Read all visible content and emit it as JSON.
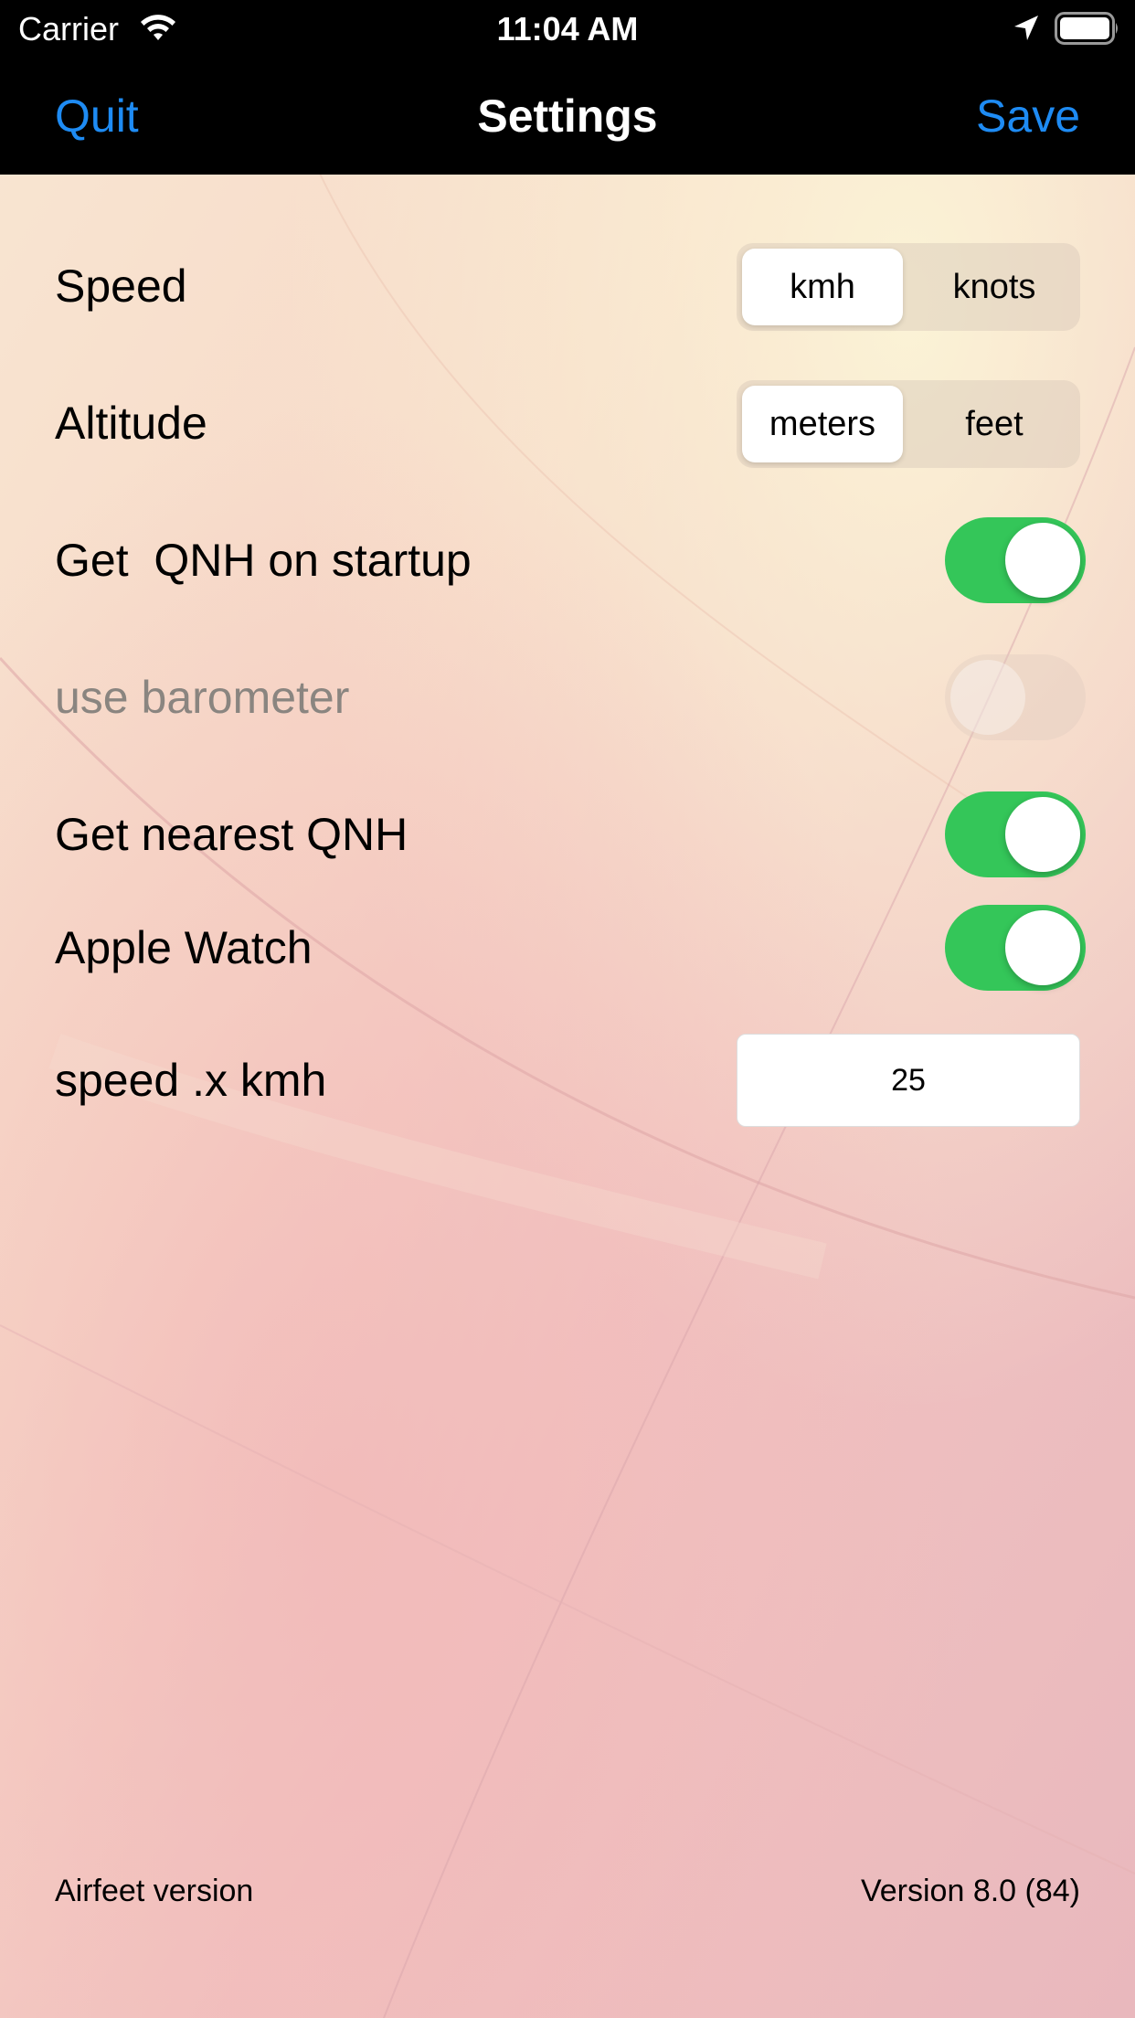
{
  "status_bar": {
    "carrier": "Carrier",
    "time": "11:04 AM",
    "icons": [
      "wifi-icon",
      "location-arrow-icon",
      "battery-icon"
    ]
  },
  "nav": {
    "left_label": "Quit",
    "title": "Settings",
    "right_label": "Save",
    "accent_color": "#1e8bf3"
  },
  "settings": {
    "speed": {
      "label": "Speed",
      "options": [
        "kmh",
        "knots"
      ],
      "selected": "kmh"
    },
    "altitude": {
      "label": "Altitude",
      "options": [
        "meters",
        "feet"
      ],
      "selected": "meters"
    },
    "qnh_startup": {
      "label": "Get  QNH on startup",
      "on": true
    },
    "barometer": {
      "label": "use barometer",
      "on": false,
      "enabled": false
    },
    "nearest_qnh": {
      "label": "Get nearest QNH",
      "on": true
    },
    "apple_watch": {
      "label": "Apple Watch",
      "on": true
    },
    "speed_x": {
      "label": "speed .x kmh",
      "value": "25"
    }
  },
  "footer": {
    "label": "Airfeet version",
    "version": "Version 8.0 (84)"
  },
  "colors": {
    "toggle_on": "#34c659",
    "nav_background": "#000000"
  }
}
